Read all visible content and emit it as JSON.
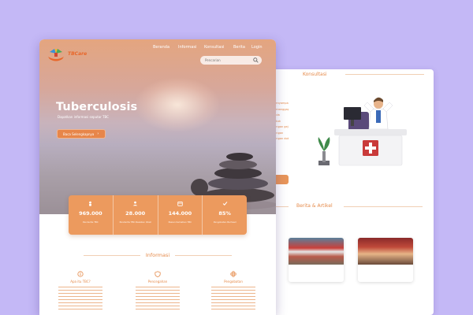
{
  "brand": {
    "name": "TBCare"
  },
  "nav": {
    "items": [
      "Beranda",
      "Informasi",
      "Konsultasi",
      "Berita",
      "Login"
    ]
  },
  "search": {
    "placeholder": "Pencarian"
  },
  "hero": {
    "title": "Tuberculosis",
    "subtitle": "Dapatkan informasi seputar TBC",
    "cta_label": "Baca Selengkapnya"
  },
  "stats": [
    {
      "icon": "person-icon",
      "value": "969.000",
      "label": "Penderita TBC"
    },
    {
      "icon": "person-check-icon",
      "value": "28.000",
      "label": "Penderita TBC Resisten Obat"
    },
    {
      "icon": "calendar-icon",
      "value": "144.000",
      "label": "Pasien Kematian TBC"
    },
    {
      "icon": "check-icon",
      "value": "85%",
      "label": "Pengobatan Berhasil"
    }
  ],
  "informasi": {
    "title": "Informasi",
    "columns": [
      {
        "icon": "info-icon",
        "heading": "Apa itu TBC?"
      },
      {
        "icon": "shield-icon",
        "heading": "Pencegahan"
      },
      {
        "icon": "plus-icon",
        "heading": "Pengobatan"
      }
    ]
  },
  "konsultasi": {
    "title": "Konsultasi",
    "snippet_lines": [
      "menyampaikan",
      "menanggapi",
      "anda",
      "untuk",
      "dengan gejala",
      "dengan",
      "dengan dokter"
    ]
  },
  "berita": {
    "title": "Berita & Artikel"
  },
  "colors": {
    "accent": "#ec9a5e",
    "text_accent": "#e58a4a",
    "background": "#c4b8f6"
  }
}
